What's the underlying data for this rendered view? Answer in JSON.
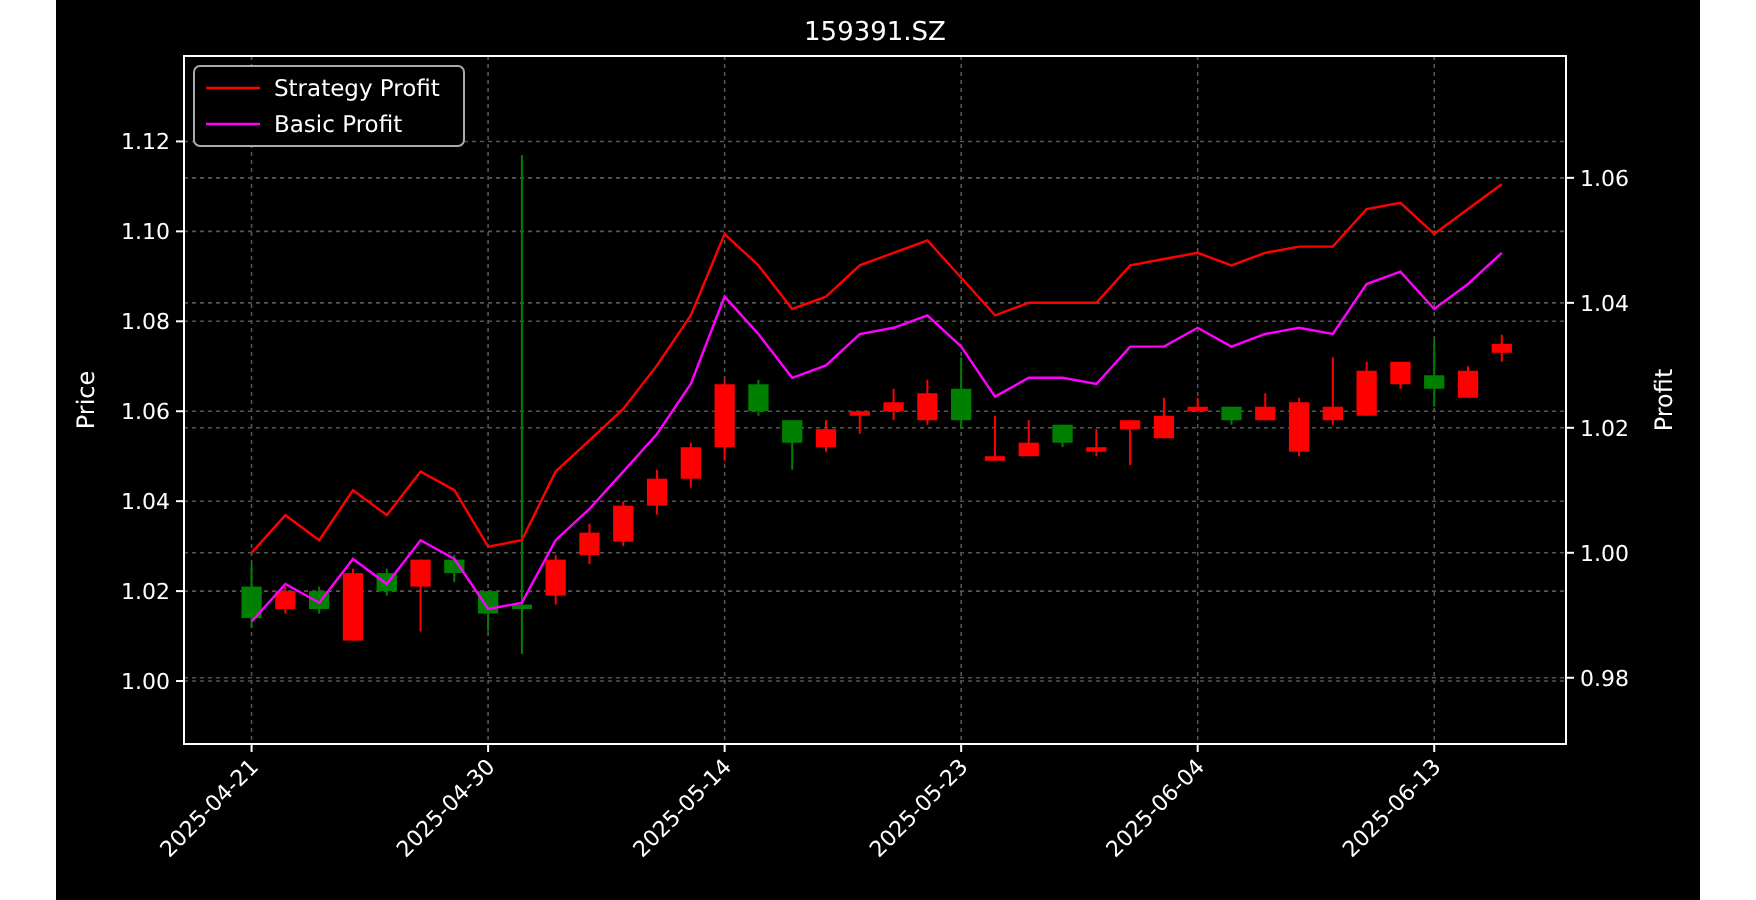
{
  "chart_data": {
    "type": "candlestick",
    "title": "159391.SZ",
    "ylabel": "Price",
    "grid": true,
    "legend": "upper left",
    "y2label": "Profit",
    "ylim": [
      0.986,
      1.139
    ],
    "y2lim": [
      0.9694,
      1.0795
    ],
    "categories": [
      "2025-04-21",
      null,
      null,
      null,
      null,
      null,
      null,
      "2025-04-30",
      null,
      null,
      null,
      null,
      null,
      null,
      "2025-05-14",
      null,
      null,
      null,
      null,
      null,
      null,
      "2025-05-23",
      null,
      null,
      null,
      null,
      null,
      null,
      "2025-06-04",
      null,
      null,
      null,
      null,
      null,
      null,
      "2025-06-13",
      null,
      null
    ],
    "yticks": [
      {
        "value": 1.0,
        "label": "1.00"
      },
      {
        "value": 1.02,
        "label": "1.02"
      },
      {
        "value": 1.04,
        "label": "1.04"
      },
      {
        "value": 1.06,
        "label": "1.06"
      },
      {
        "value": 1.08,
        "label": "1.08"
      },
      {
        "value": 1.1,
        "label": "1.10"
      },
      {
        "value": 1.12,
        "label": "1.12"
      }
    ],
    "y2ticks": [
      {
        "value": 0.98,
        "label": "0.98"
      },
      {
        "value": 1.0,
        "label": "1.00"
      },
      {
        "value": 1.02,
        "label": "1.02"
      },
      {
        "value": 1.04,
        "label": "1.04"
      },
      {
        "value": 1.06,
        "label": "1.06"
      }
    ],
    "series": [
      {
        "name": "Strategy Profit",
        "type": "line",
        "color": "#ff0000",
        "axis": "y2",
        "values": [
          1.0,
          1.006,
          1.002,
          1.01,
          1.006,
          1.013,
          1.01,
          1.001,
          1.002,
          1.013,
          1.018,
          1.023,
          1.03,
          1.038,
          1.051,
          1.046,
          1.039,
          1.041,
          1.046,
          1.048,
          1.05,
          1.044,
          1.038,
          1.04,
          1.04,
          1.04,
          1.046,
          1.047,
          1.048,
          1.046,
          1.048,
          1.049,
          1.049,
          1.055,
          1.056,
          1.051,
          1.055,
          1.059
        ]
      },
      {
        "name": "Basic Profit",
        "type": "line",
        "color": "#ff00ff",
        "axis": "y2",
        "values": [
          0.989,
          0.995,
          0.992,
          0.999,
          0.995,
          1.002,
          0.999,
          0.991,
          0.992,
          1.002,
          1.007,
          1.013,
          1.019,
          1.027,
          1.041,
          1.035,
          1.028,
          1.03,
          1.035,
          1.036,
          1.038,
          1.033,
          1.025,
          1.028,
          1.028,
          1.027,
          1.033,
          1.033,
          1.036,
          1.033,
          1.035,
          1.036,
          1.035,
          1.043,
          1.045,
          1.039,
          1.043,
          1.048
        ]
      }
    ],
    "ohlc": [
      [
        1.021,
        1.026,
        1.012,
        1.014
      ],
      [
        1.016,
        1.021,
        1.015,
        1.02
      ],
      [
        1.02,
        1.021,
        1.015,
        1.016
      ],
      [
        1.009,
        1.025,
        1.009,
        1.024
      ],
      [
        1.024,
        1.025,
        1.019,
        1.02
      ],
      [
        1.021,
        1.027,
        1.011,
        1.027
      ],
      [
        1.027,
        1.028,
        1.022,
        1.024
      ],
      [
        1.02,
        1.02,
        1.011,
        1.015
      ],
      [
        1.017,
        1.117,
        1.006,
        1.016
      ],
      [
        1.019,
        1.028,
        1.017,
        1.027
      ],
      [
        1.028,
        1.035,
        1.026,
        1.033
      ],
      [
        1.031,
        1.04,
        1.03,
        1.039
      ],
      [
        1.039,
        1.047,
        1.037,
        1.045
      ],
      [
        1.045,
        1.053,
        1.043,
        1.052
      ],
      [
        1.052,
        1.067,
        1.049,
        1.066
      ],
      [
        1.066,
        1.067,
        1.059,
        1.06
      ],
      [
        1.058,
        1.058,
        1.047,
        1.053
      ],
      [
        1.052,
        1.058,
        1.051,
        1.056
      ],
      [
        1.059,
        1.06,
        1.055,
        1.06
      ],
      [
        1.06,
        1.065,
        1.058,
        1.062
      ],
      [
        1.058,
        1.067,
        1.057,
        1.064
      ],
      [
        1.065,
        1.072,
        1.056,
        1.058
      ],
      [
        1.049,
        1.059,
        1.049,
        1.05
      ],
      [
        1.05,
        1.058,
        1.05,
        1.053
      ],
      [
        1.057,
        1.057,
        1.052,
        1.053
      ],
      [
        1.051,
        1.056,
        1.05,
        1.052
      ],
      [
        1.056,
        1.058,
        1.048,
        1.058
      ],
      [
        1.054,
        1.063,
        1.054,
        1.059
      ],
      [
        1.06,
        1.063,
        1.06,
        1.061
      ],
      [
        1.061,
        1.061,
        1.057,
        1.058
      ],
      [
        1.058,
        1.064,
        1.058,
        1.061
      ],
      [
        1.051,
        1.063,
        1.05,
        1.062
      ],
      [
        1.058,
        1.072,
        1.057,
        1.061
      ],
      [
        1.059,
        1.071,
        1.059,
        1.069
      ],
      [
        1.066,
        1.071,
        1.065,
        1.071
      ],
      [
        1.068,
        1.076,
        1.061,
        1.065
      ],
      [
        1.063,
        1.07,
        1.063,
        1.069
      ],
      [
        1.073,
        1.077,
        1.071,
        1.075
      ]
    ]
  }
}
